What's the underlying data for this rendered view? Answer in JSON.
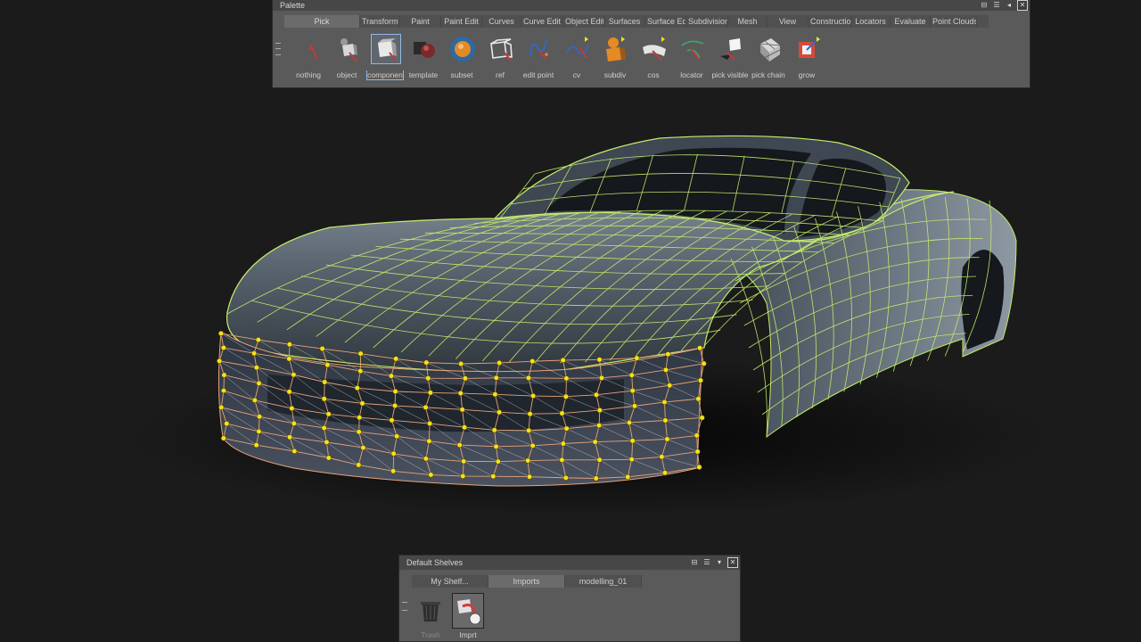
{
  "palette": {
    "title": "Palette",
    "tabs": [
      "Pick",
      "Transform",
      "Paint",
      "Paint Edit",
      "Curves",
      "Curve Edit",
      "Object Edit",
      "Surfaces",
      "Surface Edit",
      "Subdivision",
      "Mesh",
      "View",
      "Construction",
      "Locators",
      "Evaluate",
      "Point Clouds"
    ],
    "active_tab": "Pick",
    "tools": [
      {
        "label": "nothing",
        "icon": "pick-nothing-icon"
      },
      {
        "label": "object",
        "icon": "pick-object-icon"
      },
      {
        "label": "componen",
        "icon": "pick-component-icon"
      },
      {
        "label": "template",
        "icon": "pick-template-icon"
      },
      {
        "label": "subset",
        "icon": "pick-subset-icon"
      },
      {
        "label": "ref",
        "icon": "pick-ref-icon"
      },
      {
        "label": "edit point",
        "icon": "pick-edit-point-icon"
      },
      {
        "label": "cv",
        "icon": "pick-cv-icon"
      },
      {
        "label": "subdiv",
        "icon": "pick-subdiv-icon"
      },
      {
        "label": "cos",
        "icon": "pick-cos-icon"
      },
      {
        "label": "locator",
        "icon": "pick-locator-icon"
      },
      {
        "label": "pick visible",
        "icon": "pick-visible-icon"
      },
      {
        "label": "pick chain",
        "icon": "pick-chain-icon"
      },
      {
        "label": "grow",
        "icon": "pick-grow-icon"
      }
    ],
    "selected_tool": "componen"
  },
  "shelves": {
    "title": "Default Shelves",
    "tabs": [
      "My Shelf...",
      "Imports",
      "modelling_01"
    ],
    "active_tab": "Imports",
    "tools": [
      {
        "label": "Trash",
        "icon": "trash-icon"
      },
      {
        "label": "Imprt",
        "icon": "import-icon"
      }
    ]
  },
  "colors": {
    "wire": "#c4ec6a",
    "cv_point": "#f2e21a",
    "selected_hull": "#e8a37a",
    "body": "#5a6674",
    "background": "#1b1b1b"
  }
}
